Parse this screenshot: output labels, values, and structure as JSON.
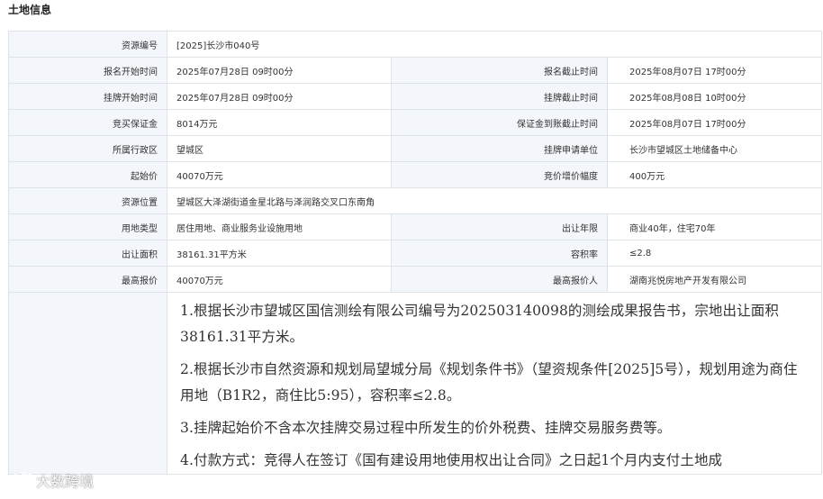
{
  "section": {
    "title": "土地信息"
  },
  "rows": {
    "resource_no": {
      "label": "资源编号",
      "value": "[2025]长沙市040号"
    },
    "reg_start": {
      "label": "报名开始时间",
      "value": "2025年07月28日 09时00分"
    },
    "reg_end": {
      "label": "报名截止时间",
      "value": "2025年08月07日 17时00分"
    },
    "list_start": {
      "label": "挂牌开始时间",
      "value": "2025年07月28日 09时00分"
    },
    "list_end": {
      "label": "挂牌截止时间",
      "value": "2025年08月08日 10时00分"
    },
    "deposit": {
      "label": "竞买保证金",
      "value": "8014万元"
    },
    "deposit_deadline": {
      "label": "保证金到账截止时间",
      "value": "2025年08月07日 17时00分"
    },
    "district": {
      "label": "所属行政区",
      "value": "望城区"
    },
    "applicant": {
      "label": "挂牌申请单位",
      "value": "长沙市望城区土地储备中心"
    },
    "start_price": {
      "label": "起始价",
      "value": "40070万元"
    },
    "increment": {
      "label": "竞价增价幅度",
      "value": "400万元"
    },
    "location": {
      "label": "资源位置",
      "value": "望城区大泽湖街道金星北路与泽润路交叉口东南角"
    },
    "usage": {
      "label": "用地类型",
      "value": "居住用地、商业服务业设施用地"
    },
    "term": {
      "label": "出让年限",
      "value": "商业40年，住宅70年"
    },
    "area": {
      "label": "出让面积",
      "value": "38161.31平方米"
    },
    "far": {
      "label": "容积率",
      "value": "≤2.8"
    },
    "top_bid": {
      "label": "最高报价",
      "value": "40070万元"
    },
    "top_bidder": {
      "label": "最高报价人",
      "value": "湖南兆悦房地产开发有限公司"
    }
  },
  "notes": [
    "1.根据长沙市望城区国信测绘有限公司编号为202503140098的测绘成果报告书，宗地出让面积38161.31平方米。",
    "2.根据长沙市自然资源和规划局望城分局《规划条件书》（望资规条件[2025]5号），规划用途为商住用地（B1R2，商住比5:95），容积率≤2.8。",
    "3.挂牌起始价不含本次挂牌交易过程中所发生的价外税费、挂牌交易服务费等。",
    "4.付款方式：竞得人在签订《国有建设用地使用权出让合同》之日起1个月内支付土地成"
  ],
  "watermark": {
    "text": "大数跨境"
  }
}
